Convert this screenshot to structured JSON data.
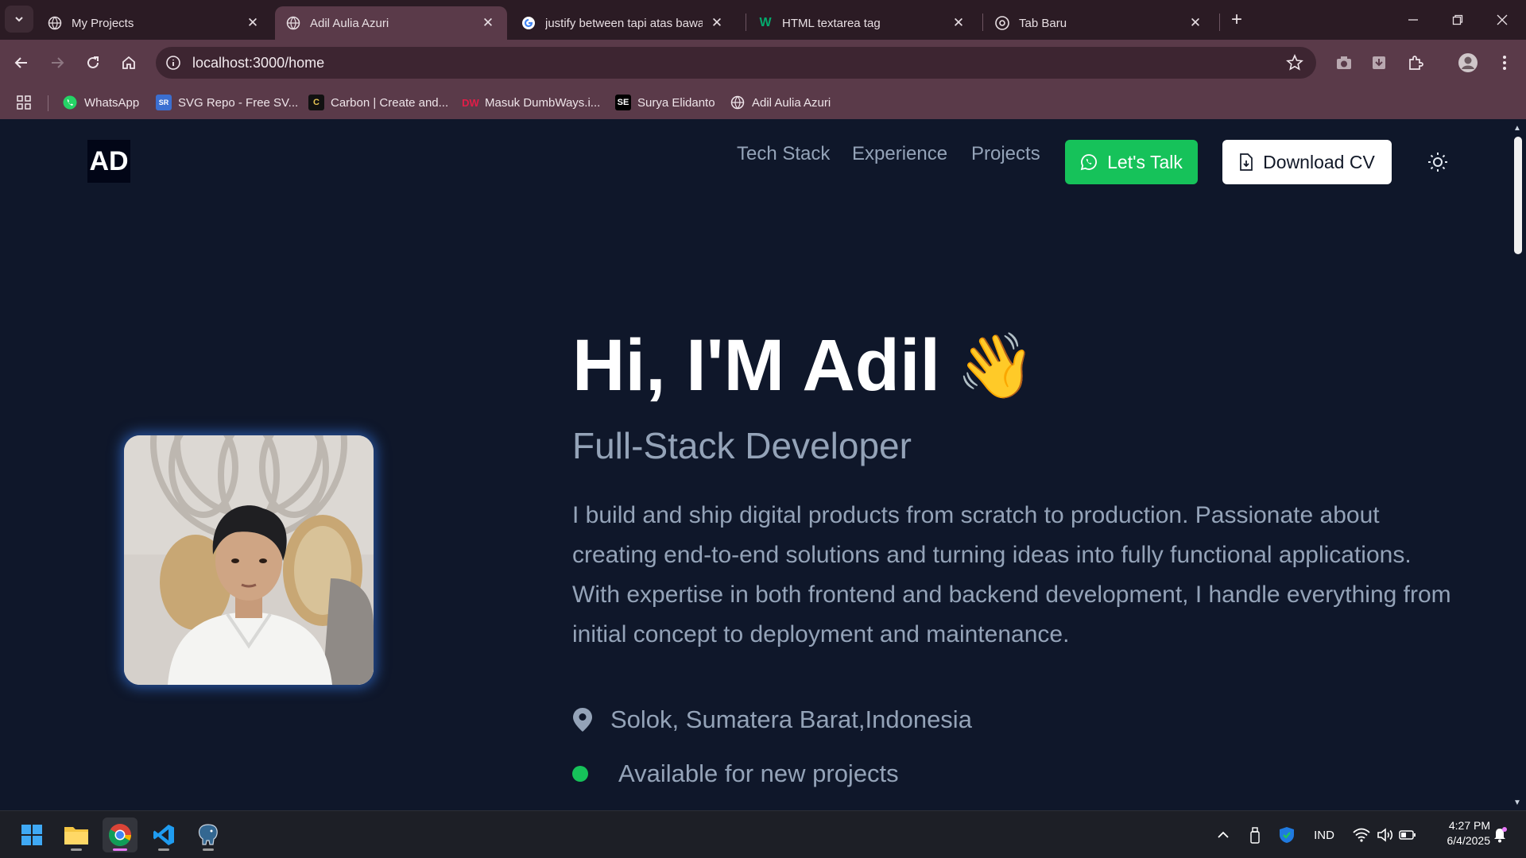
{
  "browser": {
    "tabs": [
      {
        "title": "My Projects",
        "active": false
      },
      {
        "title": "Adil Aulia Azuri",
        "active": true
      },
      {
        "title": "justify between tapi atas bawah",
        "active": false
      },
      {
        "title": "HTML textarea tag",
        "active": false
      },
      {
        "title": "Tab Baru",
        "active": false
      }
    ],
    "url": "localhost:3000/home",
    "bookmarks": [
      {
        "label": "WhatsApp"
      },
      {
        "label": "SVG Repo - Free SV..."
      },
      {
        "label": "Carbon | Create and..."
      },
      {
        "label": "Masuk DumbWays.i..."
      },
      {
        "label": "Surya Elidanto",
        "icon_text": "SE"
      },
      {
        "label": "Adil Aulia Azuri"
      }
    ]
  },
  "site": {
    "logo": "AD",
    "nav": [
      "Tech Stack",
      "Experience",
      "Projects"
    ],
    "talk_button": "Let's Talk",
    "cv_button": "Download CV",
    "hero": {
      "title": "Hi, I'M Adil",
      "wave_emoji": "👋",
      "role": "Full-Stack Developer",
      "description": "I build and ship digital products from scratch to production. Passionate about creating end-to-end solutions and turning ideas into fully functional applications. With expertise in both frontend and backend development, I handle everything from initial concept to deployment and maintenance.",
      "location": "Solok, Sumatera Barat,Indonesia",
      "availability": "Available for new projects"
    },
    "colors": {
      "accent_green": "#16c25a",
      "background": "#0f172a",
      "muted_text": "#94a3b8"
    }
  },
  "taskbar": {
    "language": "IND",
    "time": "4:27 PM",
    "date": "6/4/2025"
  }
}
